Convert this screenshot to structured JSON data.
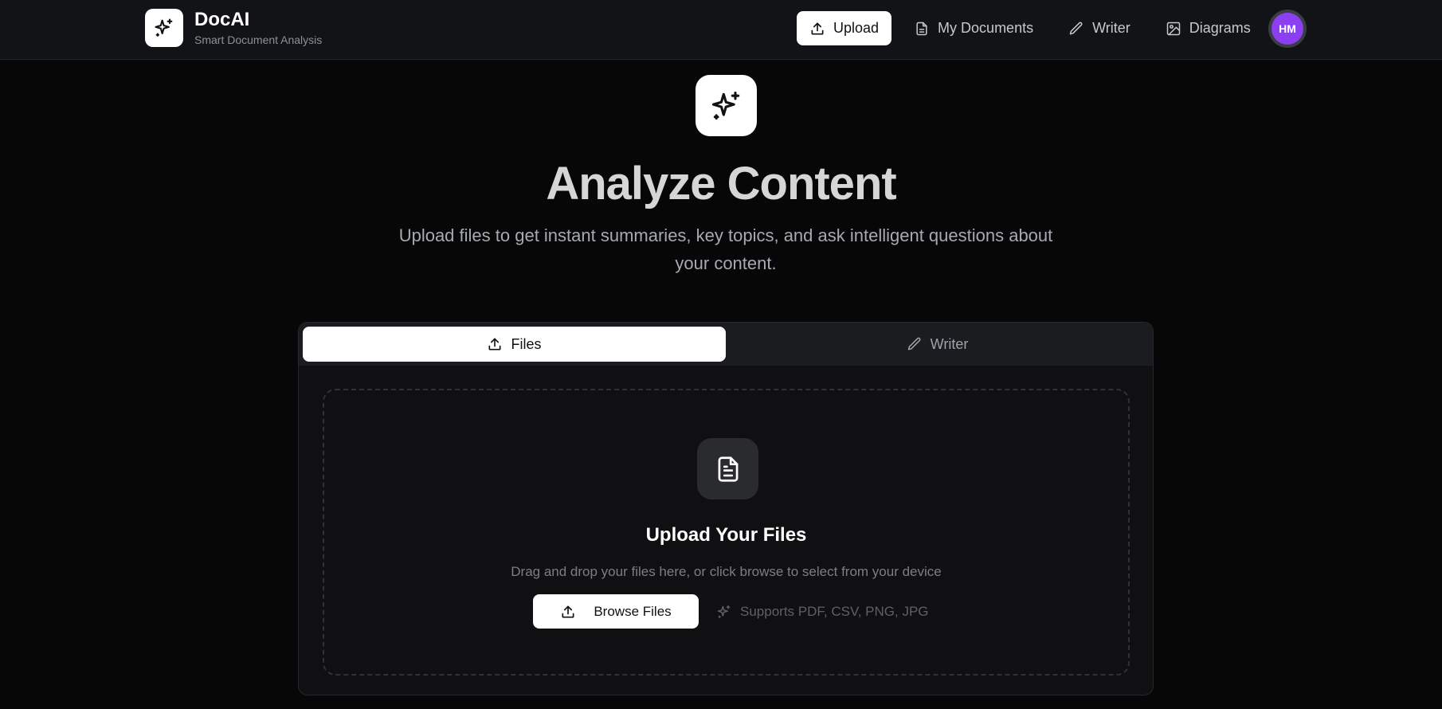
{
  "app": {
    "name": "DocAI",
    "tagline": "Smart Document Analysis"
  },
  "nav": {
    "items": [
      {
        "label": "Upload",
        "icon": "upload-icon",
        "active": true
      },
      {
        "label": "My Documents",
        "icon": "document-icon",
        "active": false
      },
      {
        "label": "Writer",
        "icon": "pen-icon",
        "active": false
      },
      {
        "label": "Diagrams",
        "icon": "image-icon",
        "active": false
      }
    ]
  },
  "user": {
    "initials": "HM",
    "avatar_color": "#8b3ff0"
  },
  "hero": {
    "icon": "sparkles-icon",
    "title": "Analyze Content",
    "subtitle": "Upload files to get instant summaries, key topics, and ask intelligent questions about your content."
  },
  "tabs": [
    {
      "label": "Files",
      "icon": "upload-icon",
      "active": true
    },
    {
      "label": "Writer",
      "icon": "pen-icon",
      "active": false
    }
  ],
  "dropzone": {
    "icon": "file-text-icon",
    "title": "Upload Your Files",
    "subtitle": "Drag and drop your files here, or click browse to select from your device",
    "browse_label": "Browse Files",
    "supports": "Supports PDF, CSV, PNG, JPG"
  }
}
